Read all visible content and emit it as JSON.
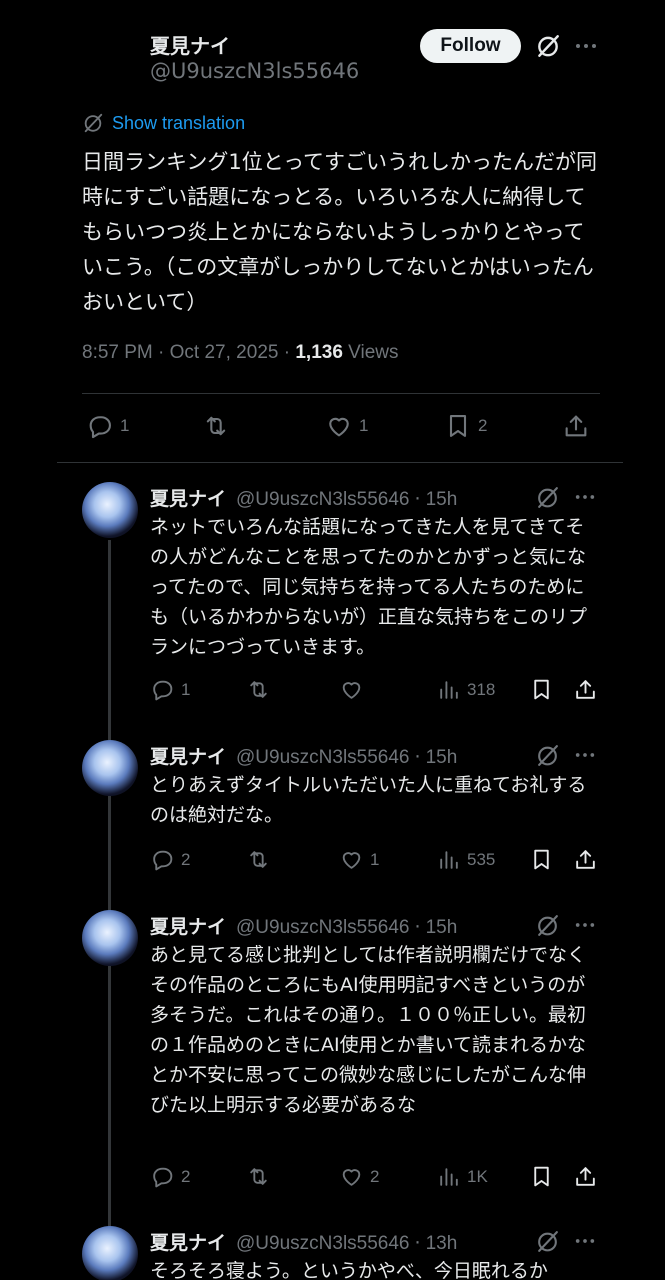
{
  "main_tweet": {
    "name": "夏見ナイ",
    "handle": "@U9uszcN3ls55646",
    "follow_label": "Follow",
    "translate_label": "Show translation",
    "text": "日間ランキング1位とってすごいうれしかったんだが同時にすごい話題になっとる。いろいろな人に納得してもらいつつ炎上とかにならないようしっかりとやっていこう。（この文章がしっかりしてないとかはいったんおいといて）",
    "time": "8:57 PM",
    "date": "Oct 27, 2025",
    "views": "1,136",
    "views_label": "Views",
    "replies": "1",
    "likes": "1",
    "bookmarks": "2"
  },
  "replies": [
    {
      "name": "夏見ナイ",
      "handle": "@U9uszcN3ls55646",
      "time": "15h",
      "text": "ネットでいろんな話題になってきた人を見てきてその人がどんなことを思ってたのかとかずっと気になってたので、同じ気持ちを持ってる人たちのためにも（いるかわからないが）正直な気持ちをこのリプランにつづっていきます。",
      "replies": "1",
      "retweets": "",
      "likes": "",
      "views": "318"
    },
    {
      "name": "夏見ナイ",
      "handle": "@U9uszcN3ls55646",
      "time": "15h",
      "text": "とりあえずタイトルいただいた人に重ねてお礼するのは絶対だな。",
      "replies": "2",
      "retweets": "",
      "likes": "1",
      "views": "535"
    },
    {
      "name": "夏見ナイ",
      "handle": "@U9uszcN3ls55646",
      "time": "15h",
      "text": "あと見てる感じ批判としては作者説明欄だけでなくその作品のところにもAI使用明記すべきというのが多そうだ。これはその通り。１００％正しい。最初の１作品めのときにAI使用とか書いて読まれるかなとか不安に思ってこの微妙な感じにしたがこんな伸びた以上明示する必要があるな",
      "replies": "2",
      "retweets": "",
      "likes": "2",
      "views": "1K"
    },
    {
      "name": "夏見ナイ",
      "handle": "@U9uszcN3ls55646",
      "time": "13h",
      "text": "そろそろ寝よう。というかやべ、今日眠れるか"
    }
  ],
  "colors": {
    "background": "#000000",
    "text": "#e7e9ea",
    "muted": "#71767b",
    "link": "#1d9bf0",
    "divider": "#2f3336"
  }
}
